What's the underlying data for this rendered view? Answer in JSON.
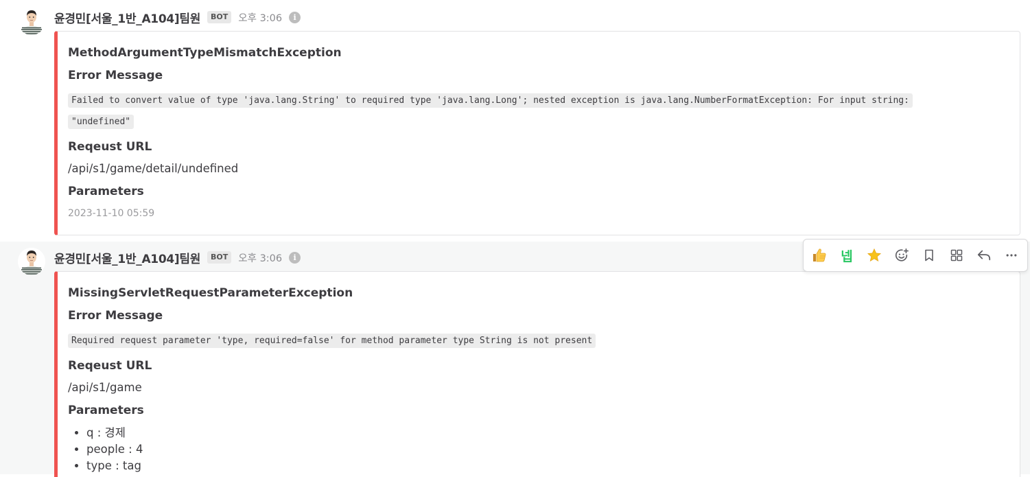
{
  "posts": [
    {
      "username": "윤경민[서울_1반_A104]팀원",
      "bot_tag": "BOT",
      "time": "오후 3:06",
      "attachment": {
        "title": "MethodArgumentTypeMismatchException",
        "error_message_label": "Error Message",
        "error_message_lines": [
          "Failed to convert value of type 'java.lang.String' to required type 'java.lang.Long'; nested exception is java.lang.NumberFormatException: For input string: ",
          "\"undefined\""
        ],
        "request_url_label": "Reqeust URL",
        "request_url": "/api/s1/game/detail/undefined",
        "parameters_label": "Parameters",
        "timestamp": "2023-11-10 05:59"
      }
    },
    {
      "username": "윤경민[서울_1반_A104]팀원",
      "bot_tag": "BOT",
      "time": "오후 3:06",
      "attachment": {
        "title": "MissingServletRequestParameterException",
        "error_message_label": "Error Message",
        "error_message": "Required request parameter 'type, required=false' for method parameter type String is not present",
        "request_url_label": "Reqeust URL",
        "request_url": "/api/s1/game",
        "parameters_label": "Parameters",
        "parameters": [
          "q : 경제",
          "people : 4",
          "type : tag"
        ]
      }
    }
  ],
  "toolbar": {
    "nep_label": "넵",
    "icons": [
      "thumbs-up-icon",
      "nep-icon",
      "star-icon",
      "add-reaction-icon",
      "bookmark-icon",
      "grid-icon",
      "reply-icon",
      "more-icon"
    ]
  },
  "colors": {
    "attachment_border": "#ef5350",
    "nep_green": "#29c762",
    "star_yellow": "#f7c21b"
  }
}
